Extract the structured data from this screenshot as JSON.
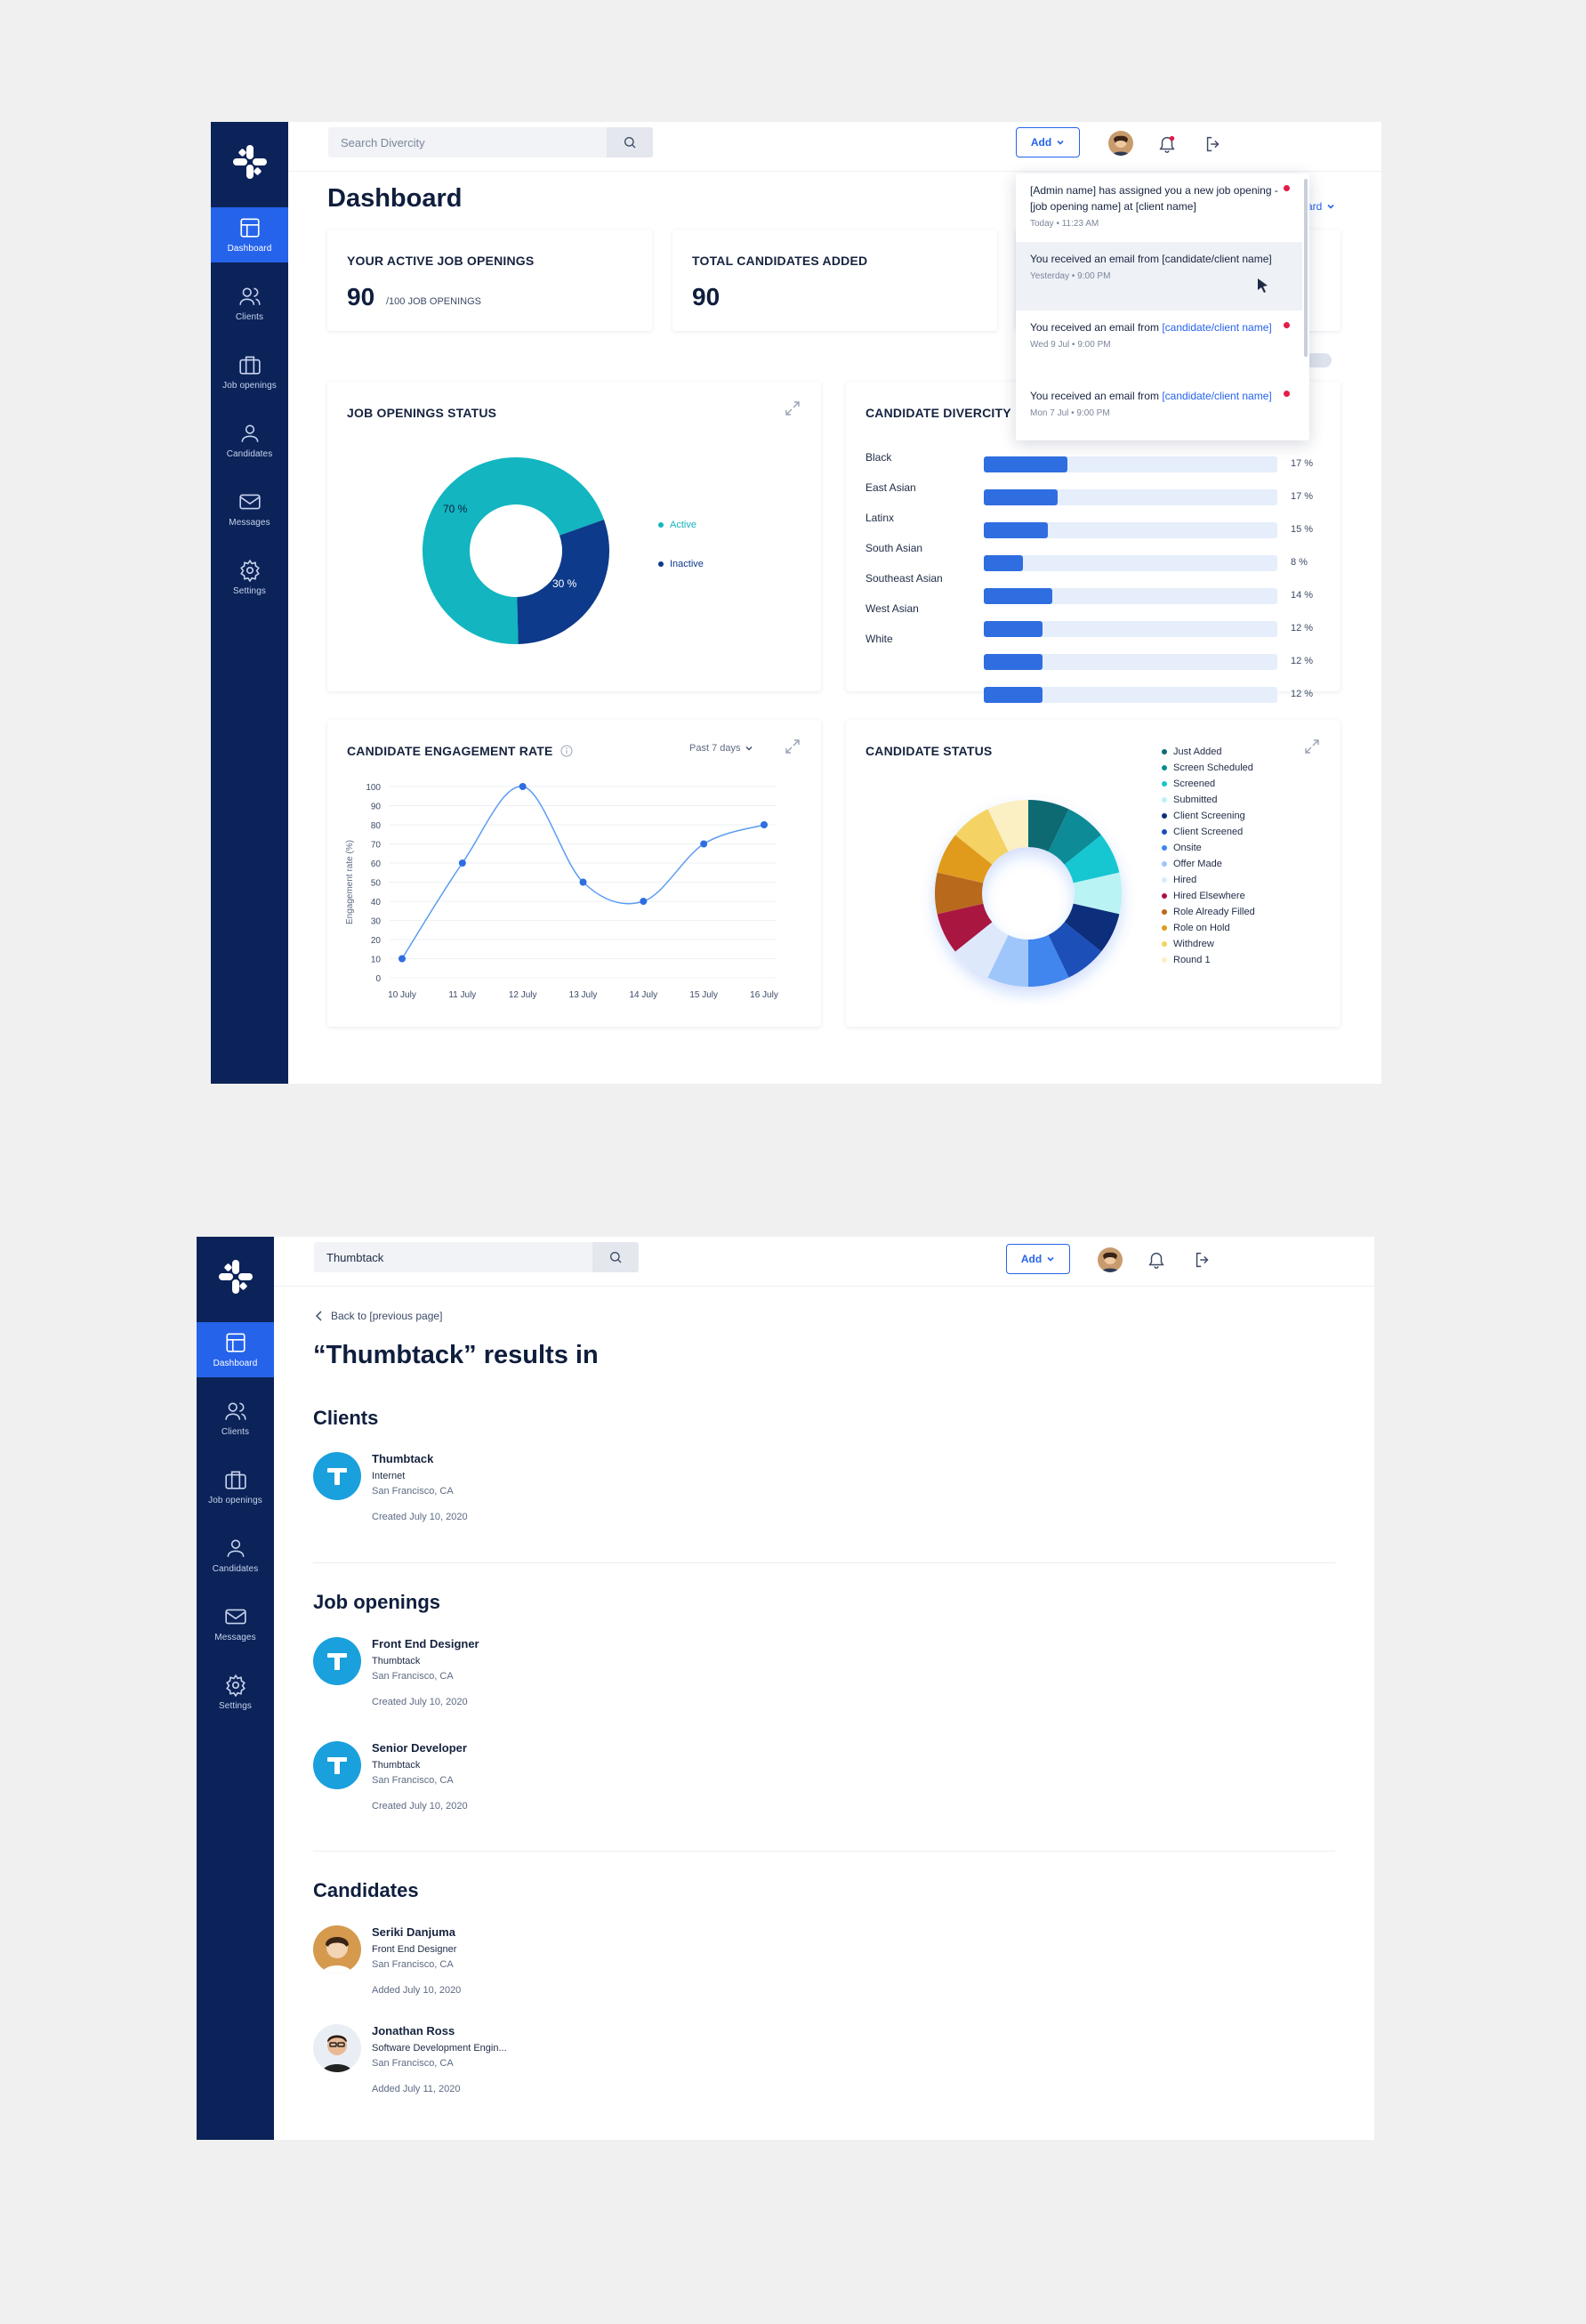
{
  "nav": [
    {
      "label": "Dashboard",
      "icon": "dashboard-icon"
    },
    {
      "label": "Clients",
      "icon": "clients-icon"
    },
    {
      "label": "Job openings",
      "icon": "briefcase-icon"
    },
    {
      "label": "Candidates",
      "icon": "candidate-icon"
    },
    {
      "label": "Messages",
      "icon": "mail-icon"
    },
    {
      "label": "Settings",
      "icon": "gear-icon"
    }
  ],
  "dashboard": {
    "search_placeholder": "Search Divercity",
    "add_label": "Add",
    "title": "Dashboard",
    "dropdown_partial": "ard",
    "kpi1": {
      "title": "YOUR ACTIVE JOB OPENINGS",
      "value": "90",
      "sub": "/100 JOB OPENINGS"
    },
    "kpi2": {
      "title": "TOTAL CANDIDATES ADDED",
      "value": "90"
    },
    "job_status": {
      "title": "JOB OPENINGS STATUS",
      "active_label": "Active",
      "inactive_label": "Inactive",
      "active_pct_label": "70 %",
      "inactive_pct_label": "30 %"
    },
    "diversity": {
      "title": "CANDIDATE DIVERCITY",
      "rows": [
        {
          "label": "Black",
          "pct": "17 %",
          "value": 17
        },
        {
          "label": "East Asian",
          "pct": "17 %",
          "value": 15
        },
        {
          "label": "Latinx",
          "pct": "15 %",
          "value": 13
        },
        {
          "label": "South Asian",
          "pct": "8 %",
          "value": 8
        },
        {
          "label": "Southeast Asian",
          "pct": "14 %",
          "value": 14
        },
        {
          "label": "West Asian",
          "pct": "12 %",
          "value": 12
        },
        {
          "label": "White",
          "pct": "12 %",
          "value": 12
        }
      ]
    },
    "engagement": {
      "title": "CANDIDATE ENGAGEMENT RATE",
      "period": "Past 7 days"
    },
    "status": {
      "title": "CANDIDATE STATUS"
    },
    "notifications": [
      {
        "pre": "[Admin name] has assigned you a new job opening - [job opening name] at [client name]",
        "link": "",
        "time": "Today  •  11:23 AM",
        "unread": true
      },
      {
        "pre": "You received an email from [candidate/client name]",
        "link": "",
        "time": "Yesterday  •  9:00 PM",
        "unread": false
      },
      {
        "pre": "You received an email from ",
        "link": "[candidate/client name]",
        "time": "Wed 9 Jul  •  9:00 PM",
        "unread": true
      },
      {
        "pre": "You received an email from ",
        "link": "[candidate/client name]",
        "time": "Mon 7 Jul  •  9:00 PM",
        "unread": true
      }
    ]
  },
  "chart_data": [
    {
      "type": "pie",
      "title": "JOB OPENINGS STATUS",
      "categories": [
        "Active",
        "Inactive"
      ],
      "values": [
        70,
        30
      ],
      "colors": [
        "#12b5c0",
        "#0d3a8a"
      ]
    },
    {
      "type": "bar",
      "title": "CANDIDATE DIVERCITY",
      "categories": [
        "Black",
        "East Asian",
        "Latinx",
        "South Asian",
        "Southeast Asian",
        "West Asian",
        "White"
      ],
      "values": [
        17,
        15,
        13,
        8,
        14,
        12,
        12
      ],
      "orientation": "horizontal"
    },
    {
      "type": "line",
      "title": "CANDIDATE ENGAGEMENT RATE",
      "ylabel": "Engagement rate (%)",
      "x": [
        "10 July",
        "11 July",
        "12 July",
        "13 July",
        "14 July",
        "15 July",
        "16 July"
      ],
      "values": [
        10,
        60,
        100,
        50,
        40,
        70,
        80
      ],
      "ylim": [
        0,
        100
      ],
      "yticks": [
        0,
        10,
        20,
        30,
        40,
        50,
        60,
        70,
        80,
        90,
        100
      ],
      "grid": true,
      "color": "#5b9cf2"
    },
    {
      "type": "pie",
      "title": "CANDIDATE STATUS",
      "legend_position": "right",
      "categories": [
        "Just Added",
        "Screen Scheduled",
        "Screened",
        "Submitted",
        "Client Screening",
        "Client Screened",
        "Onsite",
        "Offer Made",
        "Hired",
        "Hired Elsewhere",
        "Role Already Filled",
        "Role on Hold",
        "Withdrew",
        "Round 1"
      ],
      "values": [
        7,
        7,
        7,
        7,
        7,
        7,
        7,
        7,
        7,
        7,
        7,
        7,
        7,
        7
      ],
      "colors": [
        "#0e6a73",
        "#0b8b96",
        "#19c7d1",
        "#b9f3f3",
        "#0c2f7a",
        "#1b4fb8",
        "#3f86ee",
        "#9fc6fb",
        "#dde9fb",
        "#a9153f",
        "#b8691a",
        "#e09b1f",
        "#f4d263",
        "#fbefc4"
      ]
    }
  ],
  "search_page": {
    "search_value": "Thumbtack",
    "add_label": "Add",
    "back_label": "Back to [previous page]",
    "title": "“Thumbtack” results in",
    "sections": {
      "clients": "Clients",
      "jobs": "Job openings",
      "candidates": "Candidates"
    },
    "clients": [
      {
        "name": "Thumbtack",
        "l2": "Internet",
        "l3": "San Francisco, CA",
        "l4": "Created July 10, 2020"
      }
    ],
    "jobs": [
      {
        "name": "Front End Designer",
        "l2": "Thumbtack",
        "l3": "San Francisco, CA",
        "l4": "Created July 10, 2020"
      },
      {
        "name": "Senior Developer",
        "l2": "Thumbtack",
        "l3": "San Francisco, CA",
        "l4": "Created July 10, 2020"
      }
    ],
    "candidates": [
      {
        "name": "Seriki Danjuma",
        "l2": "Front End Designer",
        "l3": "San Francisco, CA",
        "l4": "Added July 10, 2020"
      },
      {
        "name": "Jonathan Ross",
        "l2": "Software Development Engin...",
        "l3": "San Francisco, CA",
        "l4": "Added July 11, 2020"
      }
    ]
  }
}
